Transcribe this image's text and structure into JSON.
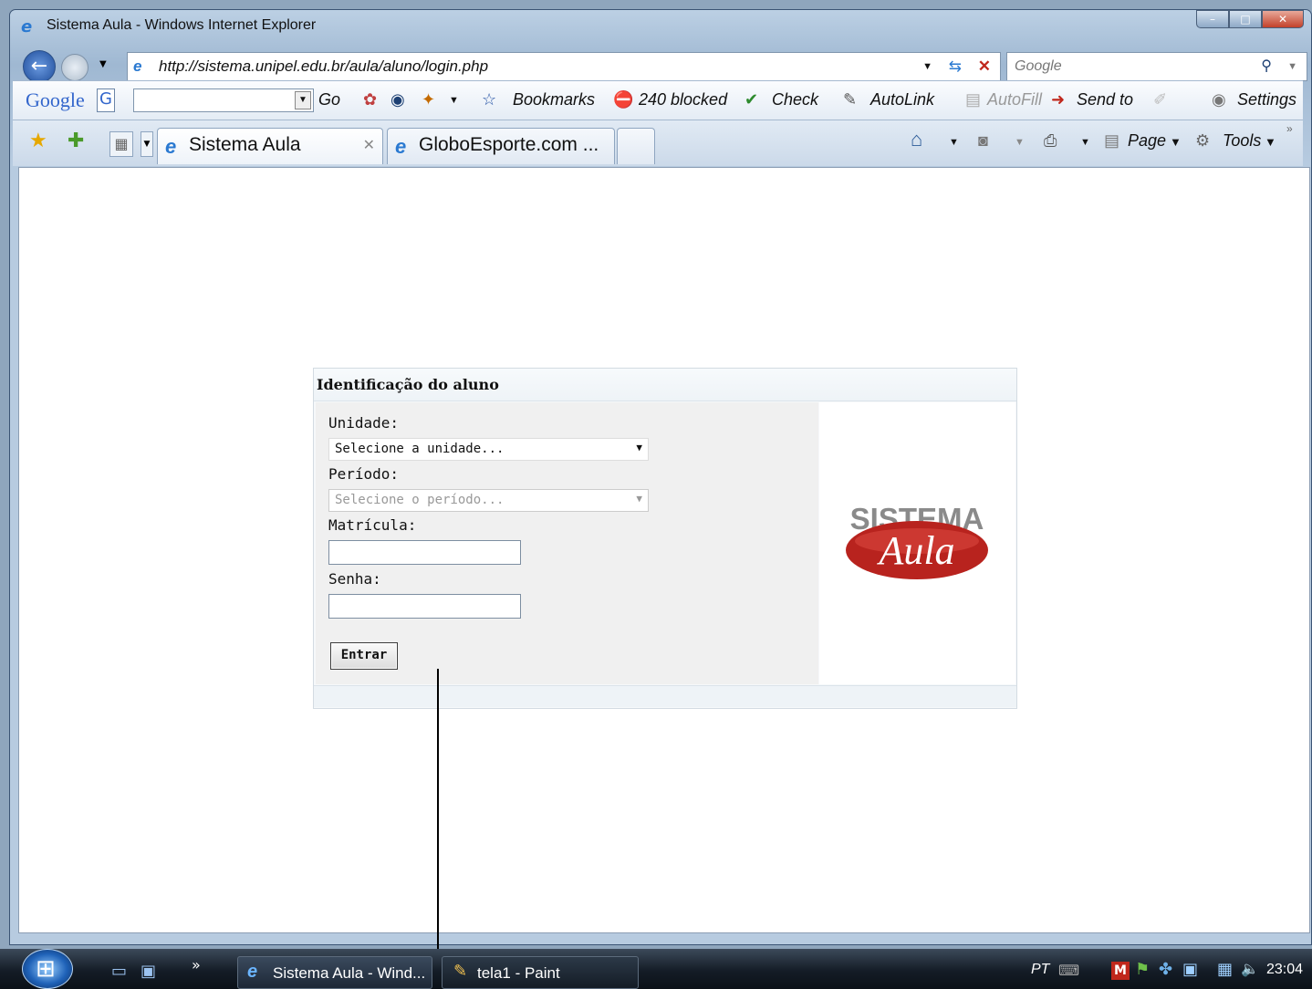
{
  "window": {
    "title": "Sistema Aula - Windows Internet Explorer"
  },
  "navbar": {
    "url": "http://sistema.unipel.edu.br/aula/aluno/login.php",
    "search_placeholder": "Google"
  },
  "google_toolbar": {
    "logo": "Google",
    "go": "Go",
    "bookmarks": "Bookmarks",
    "blocked": "240 blocked",
    "check": "Check",
    "autolink": "AutoLink",
    "autofill": "AutoFill",
    "send_to": "Send to",
    "settings": "Settings"
  },
  "tabs": [
    {
      "label": "Sistema Aula",
      "active": true
    },
    {
      "label": "GloboEsporte.com ...",
      "active": false
    }
  ],
  "command_bar": {
    "page": "Page",
    "tools": "Tools"
  },
  "login": {
    "title": "Identificação do aluno",
    "unidade_label": "Unidade:",
    "unidade_value": "Selecione a unidade...",
    "periodo_label": "Período:",
    "periodo_value": "Selecione o período...",
    "matricula_label": "Matrícula:",
    "senha_label": "Senha:",
    "submit": "Entrar"
  },
  "logo": {
    "line1": "SISTEMA",
    "line2": "Aula"
  },
  "taskbar": {
    "items": [
      {
        "label": "Sistema Aula - Wind..."
      },
      {
        "label": "tela1 - Paint"
      }
    ],
    "lang": "PT",
    "clock": "23:04"
  },
  "colors": {
    "brand_red": "#b8231e",
    "title_accent": "#2a79d1"
  }
}
